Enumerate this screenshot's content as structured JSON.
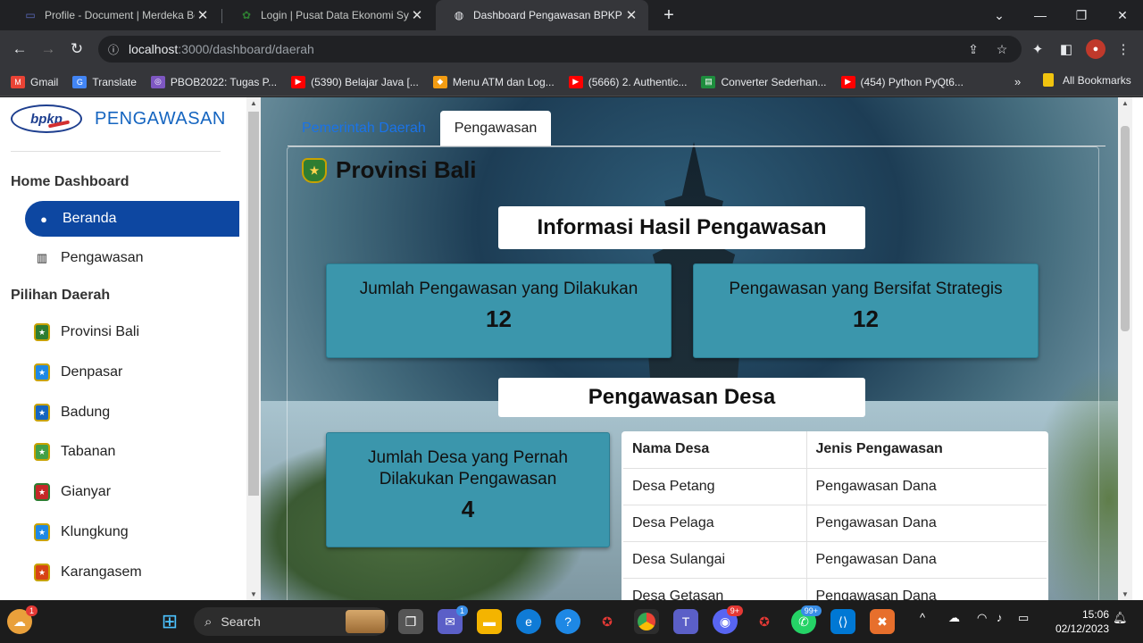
{
  "browser": {
    "tabs": [
      {
        "title": "Profile - Document | Merdeka Be",
        "active": false
      },
      {
        "title": "Login | Pusat Data Ekonomi Syar",
        "active": false
      },
      {
        "title": "Dashboard Pengawasan BPKP",
        "active": true
      }
    ],
    "url_host": "localhost",
    "url_path": ":3000/dashboard/daerah",
    "bookmarks": [
      {
        "label": "Gmail",
        "icon": "gmail-icon",
        "color": "#ea4335"
      },
      {
        "label": "Translate",
        "icon": "translate-icon",
        "color": "#4285f4"
      },
      {
        "label": "PBOB2022: Tugas P...",
        "icon": "pbob-icon",
        "color": "#7e57c2"
      },
      {
        "label": "(5390) Belajar Java [...",
        "icon": "youtube-icon",
        "color": "#ff0000"
      },
      {
        "label": "Menu ATM dan Log...",
        "icon": "box-icon",
        "color": "#f39c12"
      },
      {
        "label": "(5666) 2. Authentic...",
        "icon": "youtube-icon",
        "color": "#ff0000"
      },
      {
        "label": "Converter Sederhan...",
        "icon": "converter-icon",
        "color": "#1e8e3e"
      },
      {
        "label": "(454) Python PyQt6...",
        "icon": "youtube-icon",
        "color": "#ff0000"
      }
    ],
    "more": "»",
    "all_bookmarks": "All Bookmarks"
  },
  "sidebar": {
    "brand_logo": "bpkp",
    "brand_title": "PENGAWASAN",
    "section_home": "Home Dashboard",
    "home_items": [
      {
        "label": "Beranda",
        "icon": "user-icon"
      },
      {
        "label": "Pengawasan",
        "icon": "chart-icon"
      }
    ],
    "section_daerah": "Pilihan Daerah",
    "daerah_items": [
      {
        "label": "Provinsi Bali",
        "color": "#2e7d32"
      },
      {
        "label": "Denpasar",
        "color": "#1e88e5"
      },
      {
        "label": "Badung",
        "color": "#1565c0"
      },
      {
        "label": "Tabanan",
        "color": "#43a047"
      },
      {
        "label": "Gianyar",
        "color": "#c62828"
      },
      {
        "label": "Klungkung",
        "color": "#1e88e5"
      },
      {
        "label": "Karangasem",
        "color": "#d84315"
      }
    ]
  },
  "main": {
    "tabs": [
      "Pemerintah Daerah",
      "Pengawasan"
    ],
    "province_title": "Provinsi Bali",
    "info_heading": "Informasi Hasil Pengawasan",
    "cards": [
      {
        "label": "Jumlah Pengawasan yang Dilakukan",
        "value": "12"
      },
      {
        "label": "Pengawasan yang Bersifat Strategis",
        "value": "12"
      }
    ],
    "desa_heading": "Pengawasan Desa",
    "desa_card": {
      "label": "Jumlah Desa yang Pernah Dilakukan Pengawasan",
      "value": "4"
    },
    "table": {
      "headers": [
        "Nama Desa",
        "Jenis Pengawasan"
      ],
      "rows": [
        [
          "Desa Petang",
          "Pengawasan Dana"
        ],
        [
          "Desa Pelaga",
          "Pengawasan Dana"
        ],
        [
          "Desa Sulangai",
          "Pengawasan Dana"
        ],
        [
          "Desa Getasan",
          "Pengawasan Dana"
        ]
      ]
    }
  },
  "taskbar": {
    "search_label": "Search",
    "teams_badge": "1",
    "discord_badge": "9+",
    "whatsapp_badge": "99+",
    "time": "15:06",
    "date": "02/12/2023"
  }
}
